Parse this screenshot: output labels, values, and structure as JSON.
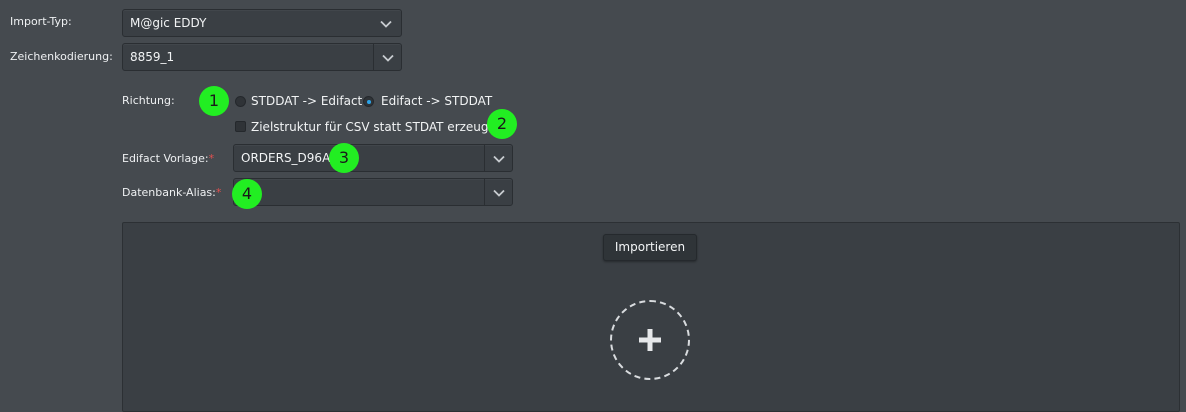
{
  "form": {
    "import_type": {
      "label": "Import-Typ:",
      "value": "M@gic EDDY"
    },
    "encoding": {
      "label": "Zeichenkodierung:",
      "value": "8859_1"
    },
    "direction": {
      "label": "Richtung:",
      "options": [
        {
          "label": "STDDAT -> Edifact",
          "checked": false
        },
        {
          "label": "Edifact -> STDDAT",
          "checked": true
        }
      ]
    },
    "csv_target": {
      "label": "Zielstruktur für CSV statt STDAT erzeugen",
      "checked": false
    },
    "edifact_template": {
      "label": "Edifact Vorlage:",
      "required_mark": "*",
      "value": "ORDERS_D96A"
    },
    "db_alias": {
      "label": "Datenbank-Alias:",
      "required_mark": "*",
      "value": ""
    }
  },
  "dropzone": {
    "import_button": "Importieren",
    "add_icon": "plus-icon"
  },
  "annotations": [
    "1",
    "2",
    "3",
    "4"
  ],
  "colors": {
    "background": "#454a4f",
    "field": "#3a3f44",
    "accent_radio": "#2ba3e8",
    "badge": "#22ee22",
    "required": "#e25050"
  }
}
